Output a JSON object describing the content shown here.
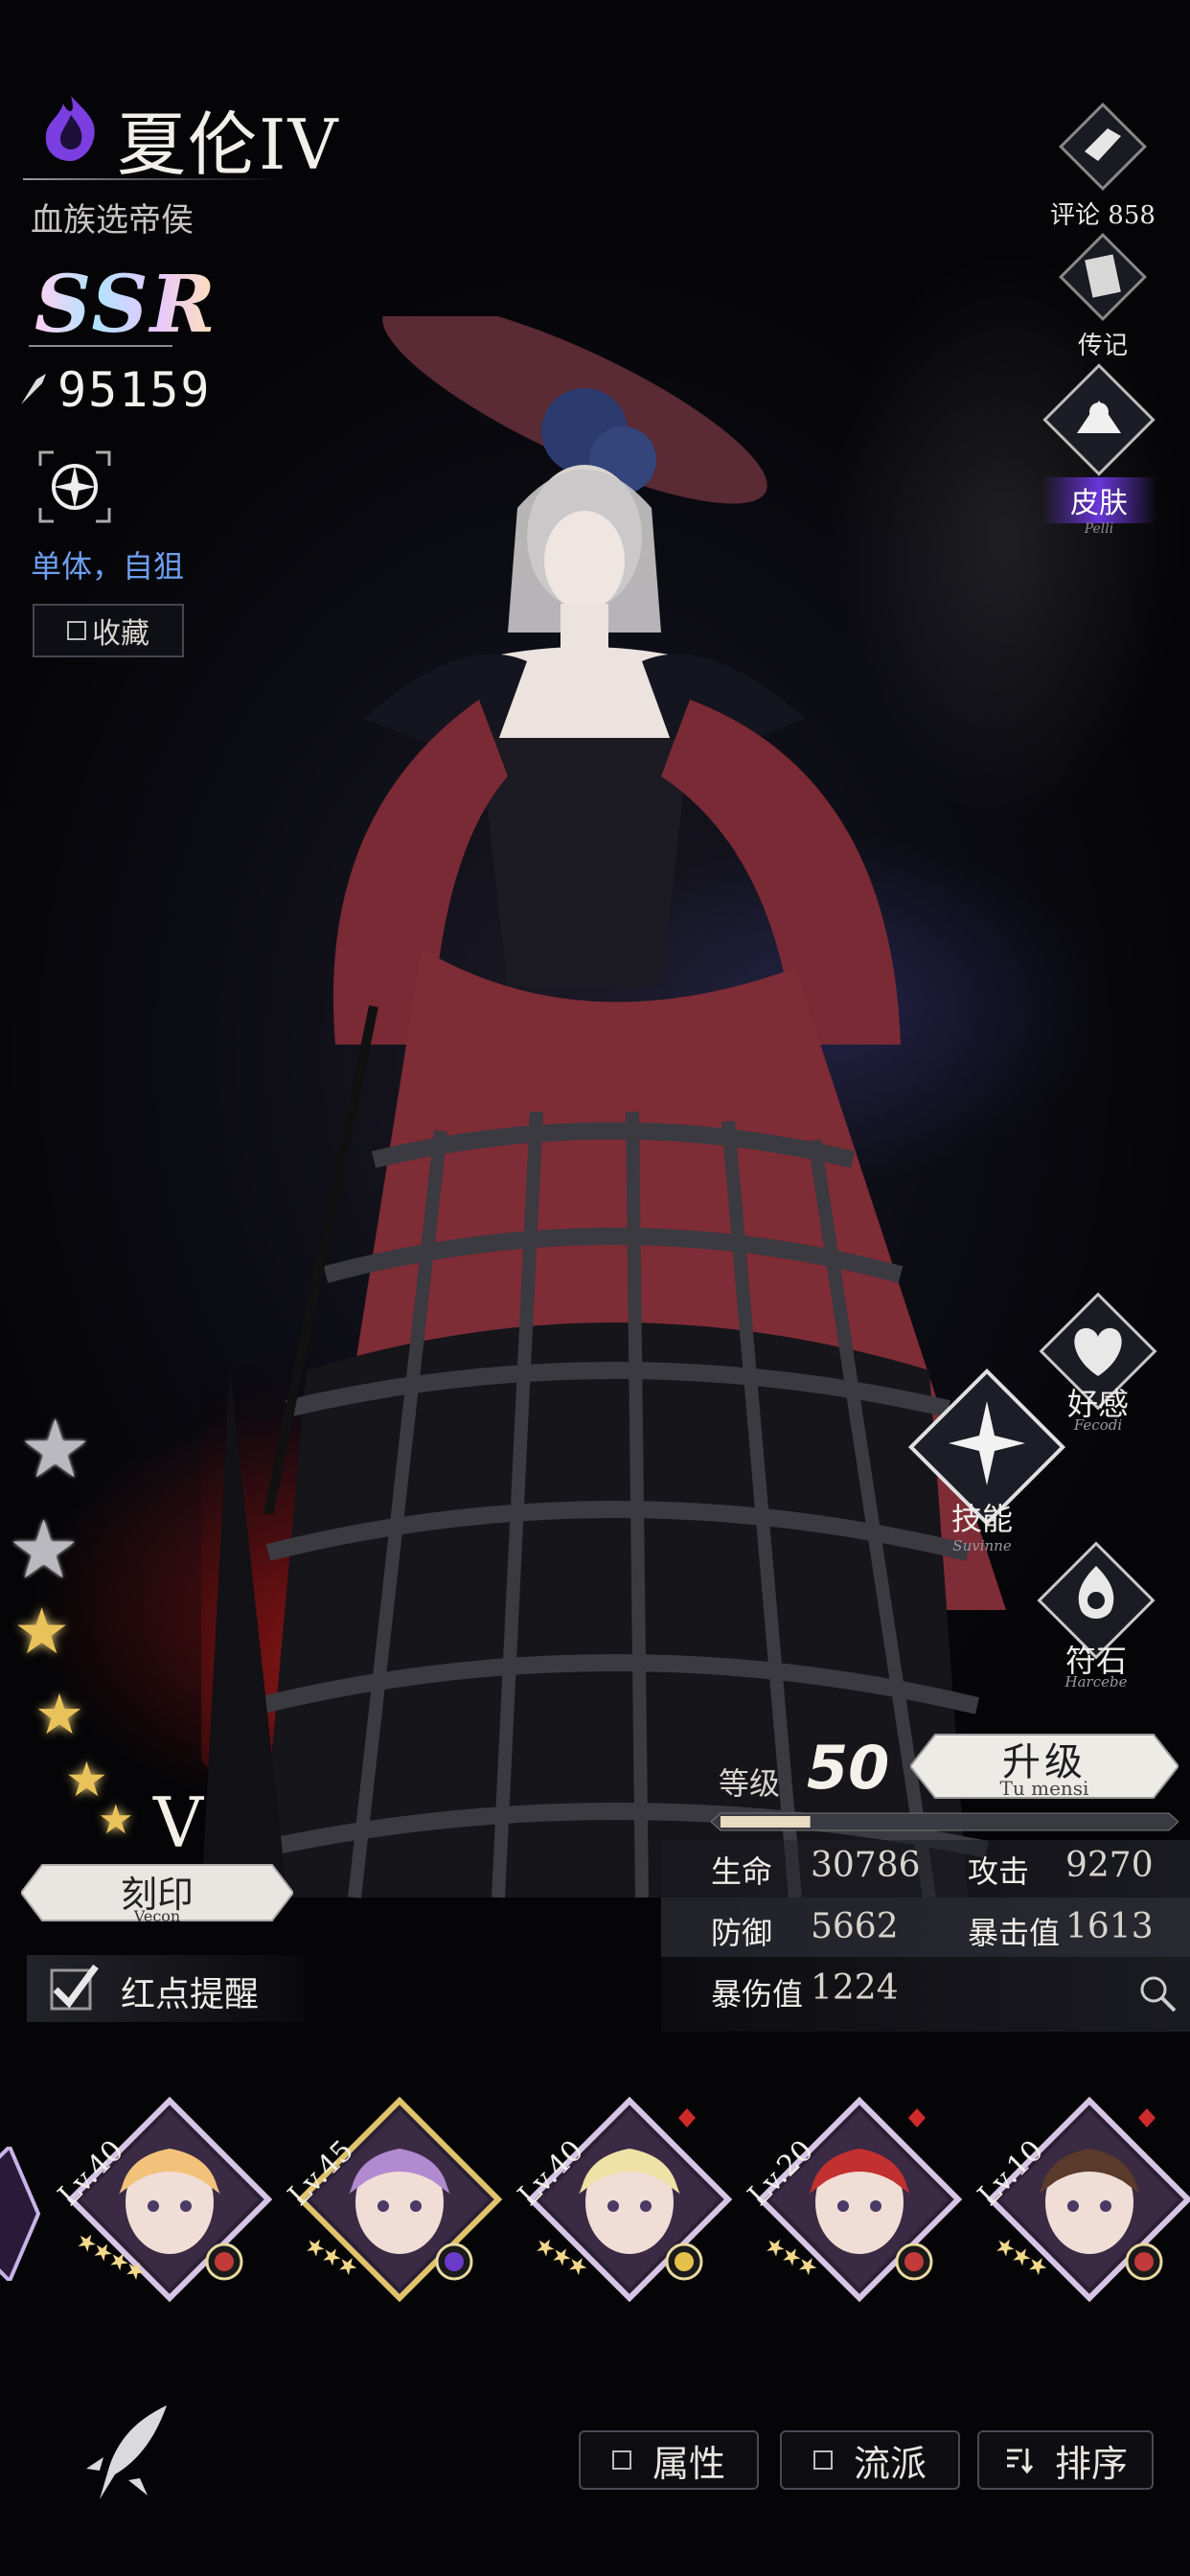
{
  "character": {
    "name": "夏伦IV",
    "title": "血族选帝侯",
    "rarity": "SSR",
    "power": "95159",
    "target_type": "单体，自狙",
    "collect_label": "收藏"
  },
  "side_menu": {
    "comments_label": "评论 858",
    "biography_label": "传记",
    "skin_label": "皮肤",
    "skin_sub": "Pelli"
  },
  "actions": {
    "affection_label": "好感",
    "affection_sub": "Fecodi",
    "skill_label": "技能",
    "skill_sub": "Suvinne",
    "rune_label": "符石",
    "rune_sub": "Harcebe"
  },
  "imprint": {
    "rank": "V",
    "label": "刻印",
    "sub": "Vecon",
    "stars_silver": 2,
    "stars_gold": 4
  },
  "reminder": {
    "label": "红点提醒",
    "checked": true
  },
  "level": {
    "label": "等级",
    "value": "50",
    "upgrade_label": "升级",
    "upgrade_sub": "Tu mensi",
    "exp_fraction": 0.2
  },
  "stats": {
    "hp_label": "生命",
    "hp_value": "30786",
    "atk_label": "攻击",
    "atk_value": "9270",
    "def_label": "防御",
    "def_value": "5662",
    "crit_label": "暴击值",
    "crit_value": "1613",
    "critdmg_label": "暴伤值",
    "critdmg_value": "1224"
  },
  "roster": [
    {
      "level": "Lv.40",
      "stars": 4,
      "hair": "#f2c27a",
      "frame": "#d7c5e6",
      "badge_color": "#c23a3a",
      "new": false
    },
    {
      "level": "Lv.45",
      "stars": 3,
      "hair": "#b28ad0",
      "frame": "#e0c36a",
      "badge_color": "#6a3bc9",
      "new": false
    },
    {
      "level": "Lv.40",
      "stars": 3,
      "hair": "#efe2a6",
      "frame": "#d7c5e6",
      "badge_color": "#e5c04b",
      "new": true
    },
    {
      "level": "Lv.20",
      "stars": 3,
      "hair": "#c23030",
      "frame": "#d7c5e6",
      "badge_color": "#c23a3a",
      "new": true
    },
    {
      "level": "Lv.10",
      "stars": 3,
      "hair": "#5a3a2a",
      "frame": "#d7c5e6",
      "badge_color": "#c23a3a",
      "new": true
    }
  ],
  "bottom": {
    "attribute_label": "属性",
    "faction_label": "流派",
    "sort_label": "排序"
  },
  "colors": {
    "accent_purple": "#6a36d8",
    "target_blue": "#6f9ff0",
    "gold_star": "#e9c35a"
  }
}
